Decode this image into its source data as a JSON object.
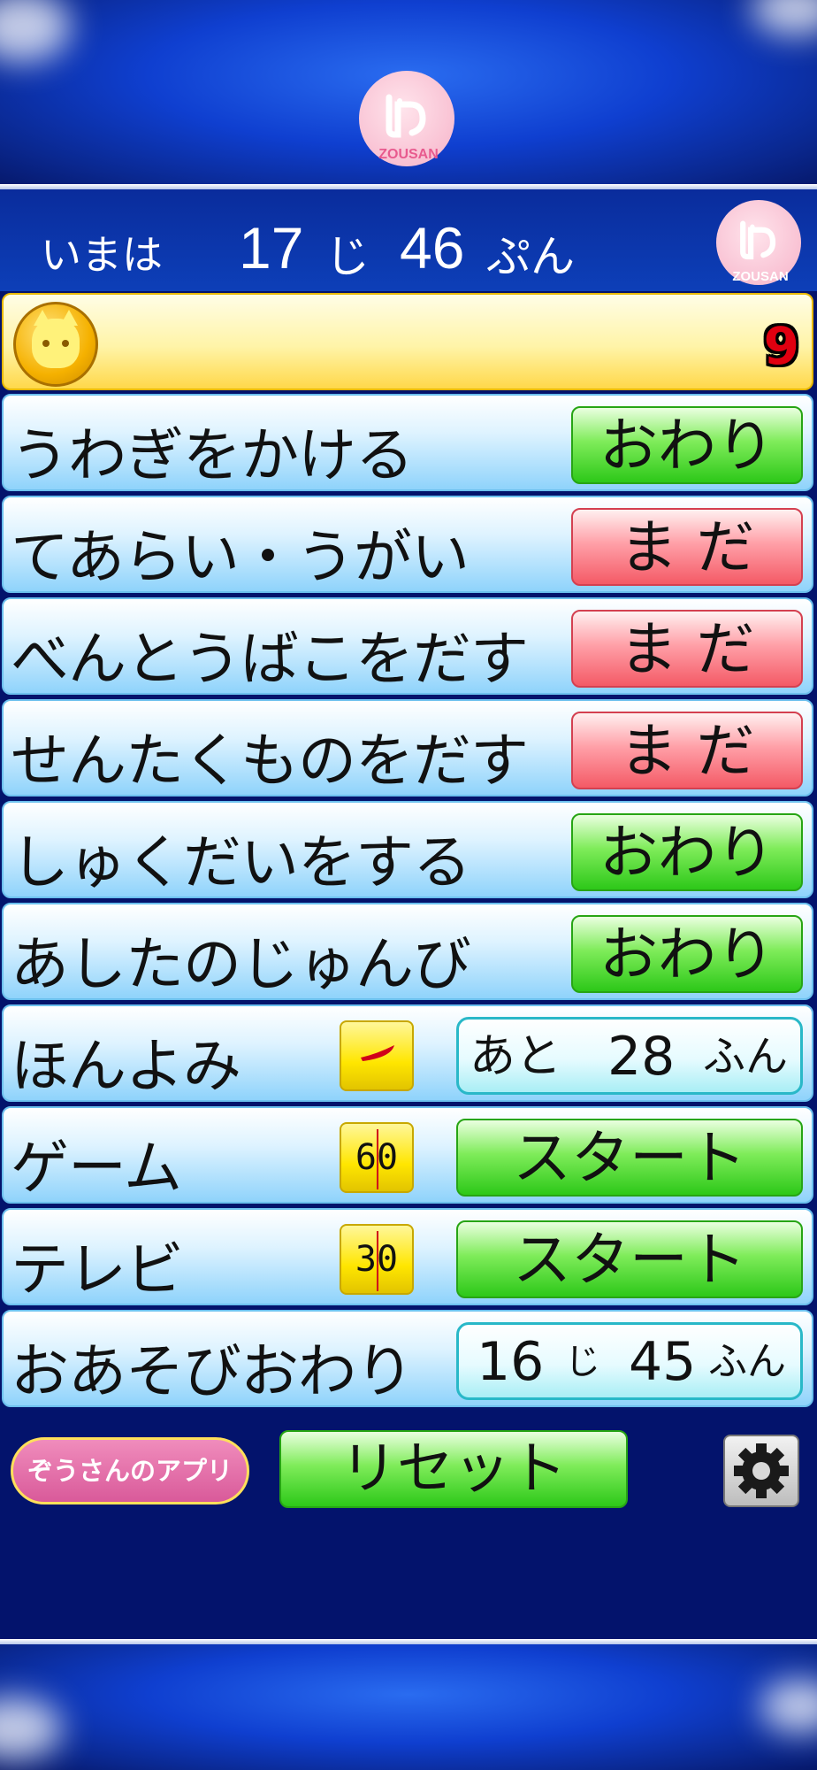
{
  "banner": {
    "logo_text": "ZOUSAN"
  },
  "header": {
    "now_label": "いまは",
    "hour": "17",
    "hour_unit": "じ",
    "minute": "46",
    "minute_unit": "ぷん",
    "logo_text": "ZOUSAN"
  },
  "score": {
    "value": "9"
  },
  "tasks": [
    {
      "label": "うわぎをかける",
      "status": "おわり",
      "status_color": "#2dc819"
    },
    {
      "label": "てあらい・うがい",
      "status": "ま だ",
      "status_color": "#f45a66"
    },
    {
      "label": "べんとうばこをだす",
      "status": "ま だ",
      "status_color": "#f45a66"
    },
    {
      "label": "せんたくものをだす",
      "status": "ま だ",
      "status_color": "#f45a66"
    },
    {
      "label": "しゅくだいをする",
      "status": "おわり",
      "status_color": "#2dc819"
    },
    {
      "label": "あしたのじゅんび",
      "status": "おわり",
      "status_color": "#2dc819"
    }
  ],
  "activities": [
    {
      "label": "ほんよみ",
      "badge": "",
      "remaining_prefix": "あと",
      "remaining_value": "28",
      "remaining_unit": "ふん"
    },
    {
      "label": "ゲーム",
      "badge": "60",
      "button": "スタート"
    },
    {
      "label": "テレビ",
      "badge": "30",
      "button": "スタート"
    }
  ],
  "play_end": {
    "label": "おあそびおわり",
    "hour": "16",
    "hour_unit": "じ",
    "minute": "45",
    "minute_unit": "ふん"
  },
  "footer": {
    "apps_label": "ぞうさんのアプリ",
    "reset_label": "リセット"
  }
}
